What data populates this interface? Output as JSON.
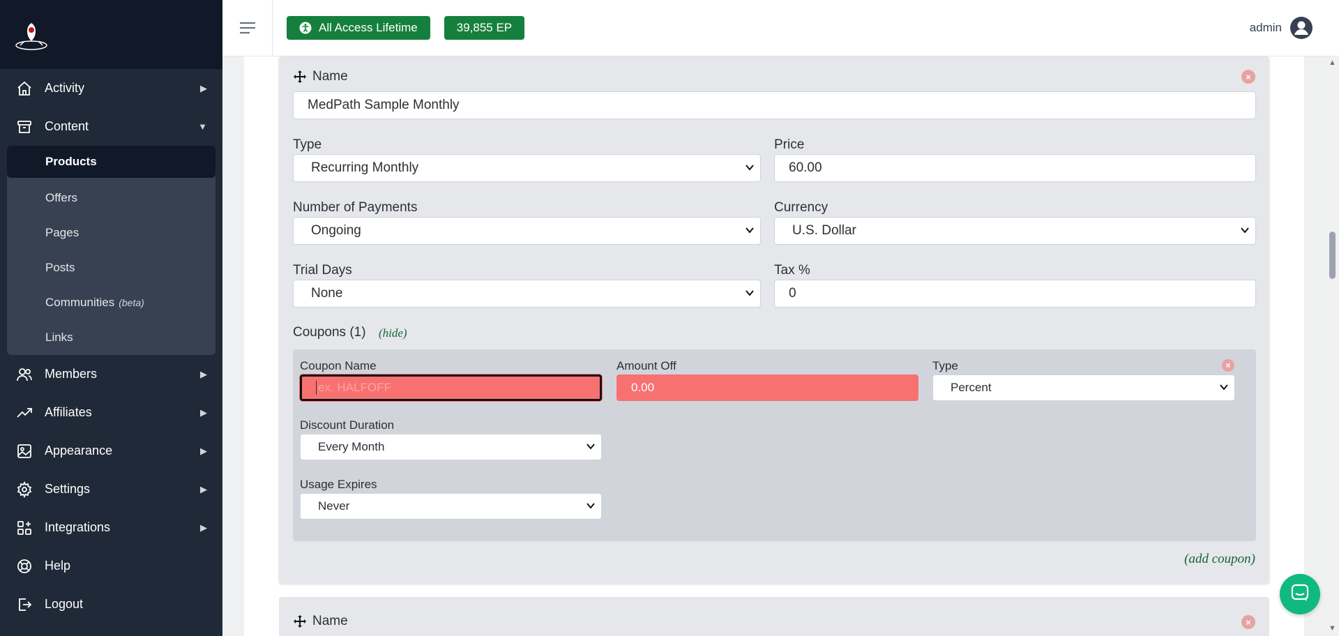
{
  "sidebar": {
    "items": [
      {
        "label": "Activity",
        "icon": "home-icon"
      },
      {
        "label": "Content",
        "icon": "archive-icon"
      },
      {
        "label": "Members",
        "icon": "users-icon"
      },
      {
        "label": "Affiliates",
        "icon": "trending-icon"
      },
      {
        "label": "Appearance",
        "icon": "image-icon"
      },
      {
        "label": "Settings",
        "icon": "gear-icon"
      },
      {
        "label": "Integrations",
        "icon": "grid-plus-icon"
      },
      {
        "label": "Help",
        "icon": "lifebuoy-icon"
      },
      {
        "label": "Logout",
        "icon": "logout-icon"
      }
    ],
    "content_sub": [
      {
        "label": "Products"
      },
      {
        "label": "Offers"
      },
      {
        "label": "Pages"
      },
      {
        "label": "Posts"
      },
      {
        "label": "Communities",
        "badge": "(beta)"
      },
      {
        "label": "Links"
      }
    ]
  },
  "topbar": {
    "access_label": "All Access Lifetime",
    "ep_label": "39,855 EP",
    "user": "admin",
    "accent": "#15803d"
  },
  "form": {
    "name_label": "Name",
    "name_value": "MedPath Sample Monthly",
    "type_label": "Type",
    "type_value": "Recurring Monthly",
    "price_label": "Price",
    "price_value": "60.00",
    "payments_label": "Number of Payments",
    "payments_value": "Ongoing",
    "currency_label": "Currency",
    "currency_value": "U.S. Dollar",
    "trial_label": "Trial Days",
    "trial_value": "None",
    "tax_label": "Tax %",
    "tax_value": "0",
    "coupons_title": "Coupons (1)",
    "hide_link": "(hide)",
    "add_coupon": "(add coupon)",
    "close_symbol": "×"
  },
  "coupon": {
    "name_label": "Coupon Name",
    "name_placeholder": "ex. HALFOFF",
    "amount_label": "Amount Off",
    "amount_value": "0.00",
    "type_label": "Type",
    "type_value": "Percent",
    "duration_label": "Discount Duration",
    "duration_value": "Every Month",
    "expires_label": "Usage Expires",
    "expires_value": "Never"
  },
  "next_card": {
    "name_label": "Name"
  },
  "scrollbar": {
    "up": "▲",
    "down": "▼"
  },
  "arrows": {
    "right": "▶",
    "down": "▼"
  }
}
